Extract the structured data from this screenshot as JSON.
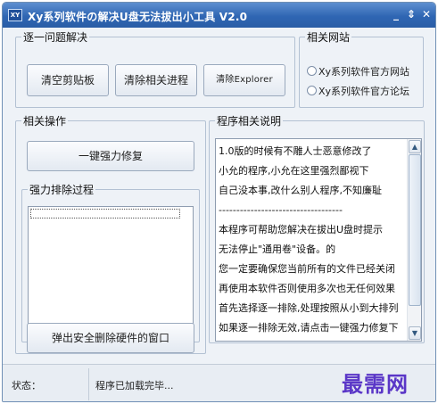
{
  "window": {
    "icon_text": "XY",
    "title": "Xy系列软件の解决U盘无法拔出小工具 V2.0",
    "minimize": "_",
    "restore": "⇕",
    "close": "✕"
  },
  "group_issues": {
    "legend": "逐一问题解决",
    "buttons": [
      "清空剪贴板",
      "清除相关进程",
      "清除Explorer"
    ]
  },
  "group_sites": {
    "legend": "相关网站",
    "links": [
      "Xy系列软件官方网站",
      "Xy系列软件官方论坛"
    ]
  },
  "group_ops": {
    "legend": "相关操作",
    "force_fix_button": "一键强力修复",
    "process_legend": "强力排除过程",
    "eject_button": "弹出安全删除硬件的窗口"
  },
  "group_notes": {
    "legend": "程序相关说明",
    "lines": [
      "1.0版的时候有不雕人士恶意修改了",
      "小允的程序,小允在这里强烈鄙视下",
      "自己没本事,改什么别人程序,不知廉耻",
      "-----------------------------------",
      "本程序可帮助您解决在拔出U盘时提示",
      "无法停止\"通用卷\"设备。的",
      "您一定要确保您当前所有的文件已经关闭",
      "再使用本软件否则使用多次也无任何效果",
      "首先选择逐一排除,处理按照从小到大排列",
      "如果逐一排除无效,请点击一键强力修复下"
    ]
  },
  "status": {
    "label": "状态：",
    "text": "程序已加载完毕...",
    "watermark": "最需网"
  }
}
